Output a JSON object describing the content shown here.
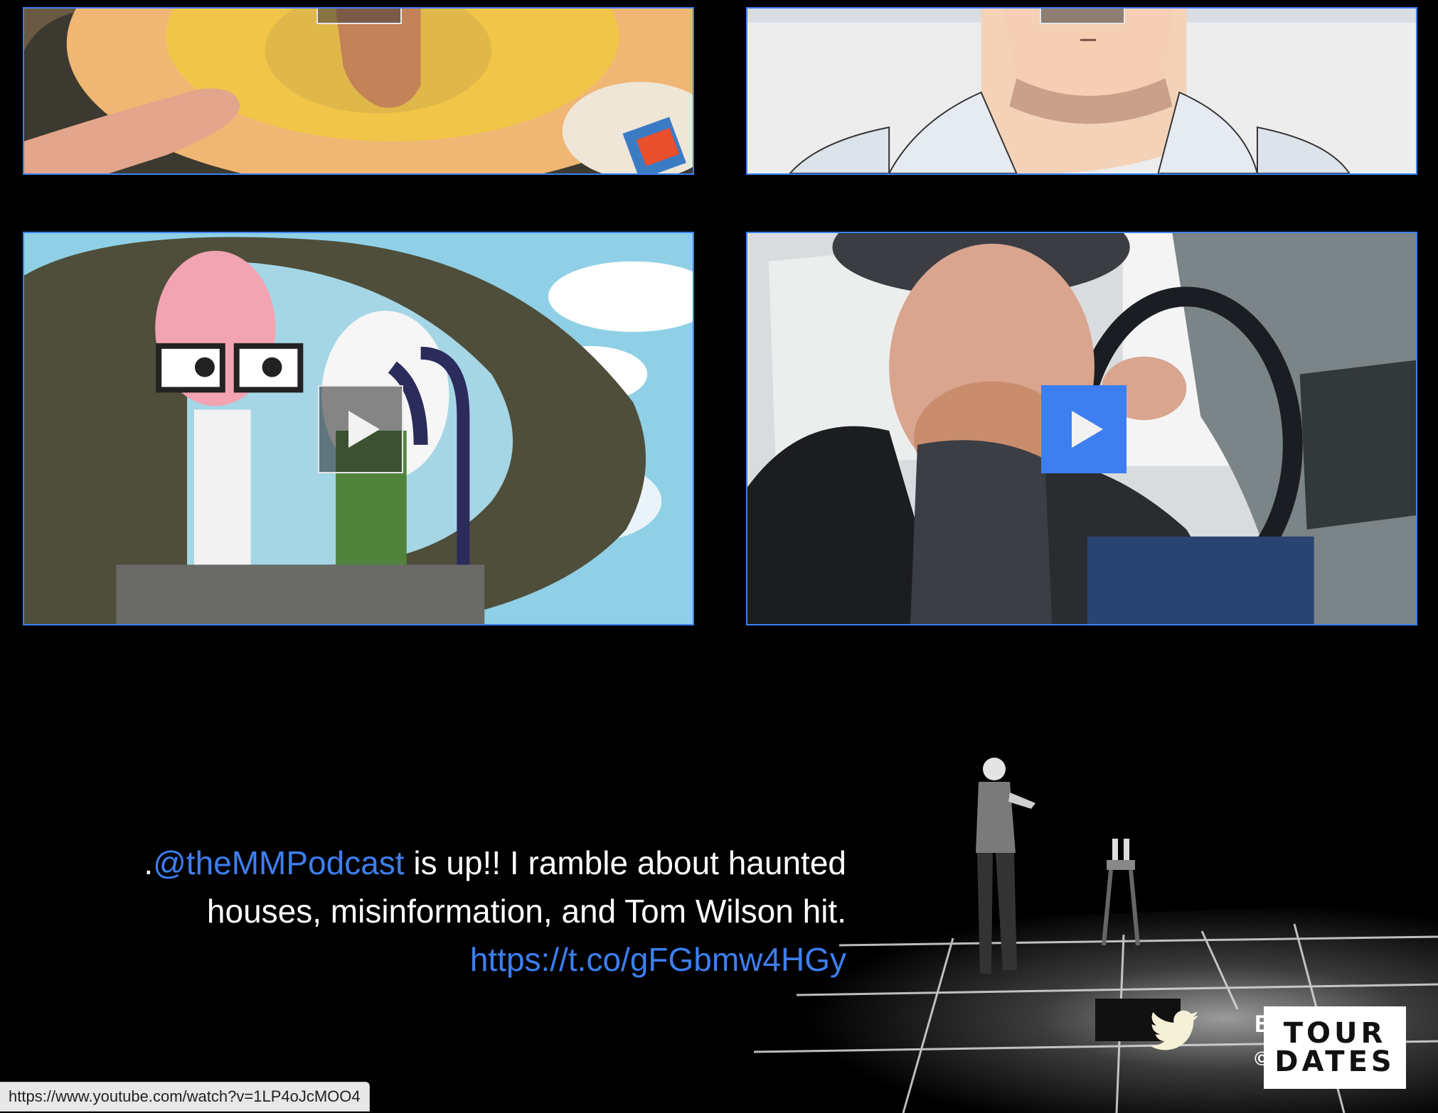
{
  "videos": [
    {
      "id": "video-1",
      "description": "cooking bowl thumbnail",
      "play_style": "dark"
    },
    {
      "id": "video-2",
      "description": "anime character thumbnail",
      "play_style": "dark"
    },
    {
      "id": "video-3",
      "description": "cartoon cockpit thumbnail",
      "play_style": "dark"
    },
    {
      "id": "video-4",
      "description": "man in truck thumbnail",
      "play_style": "blue"
    }
  ],
  "tweet": {
    "prefix": ".",
    "mention": "@theMMPodcast",
    "text": " is up!! I ramble about haunted houses, misinformation, and Tom Wilson hit.",
    "link": "https://t.co/gFGbmw4HGy"
  },
  "footer": {
    "partial_letter": "B",
    "partial_copyright": "©",
    "tour_dates_line1": "TOUR",
    "tour_dates_line2": "DATES"
  },
  "status_bar": {
    "url": "https://www.youtube.com/watch?v=1LP4oJcMOO4"
  },
  "icons": {
    "twitter": "twitter-bird-icon",
    "play": "play-icon"
  },
  "colors": {
    "accent": "#3d7ff0",
    "background": "#000000"
  }
}
